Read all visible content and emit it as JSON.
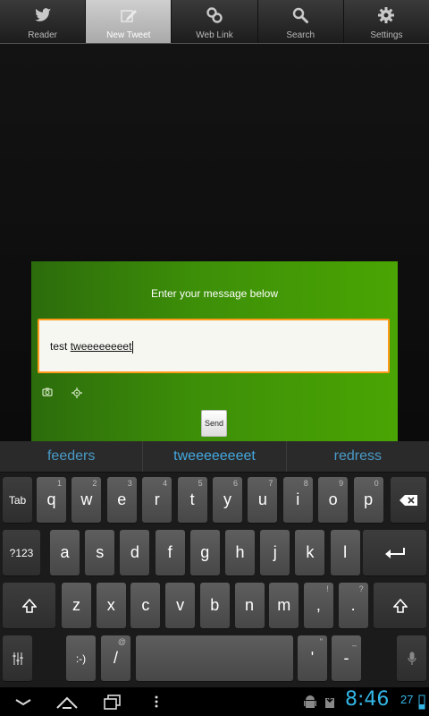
{
  "tabs": [
    {
      "label": "Reader",
      "icon": "bird-icon"
    },
    {
      "label": "New Tweet",
      "icon": "compose-icon"
    },
    {
      "label": "Web Link",
      "icon": "link-icon"
    },
    {
      "label": "Search",
      "icon": "search-icon"
    },
    {
      "label": "Settings",
      "icon": "gear-icon"
    }
  ],
  "active_tab": "New Tweet",
  "dialog": {
    "title": "Enter your message below",
    "message_value": "test tweeeeeeeet",
    "message_prefix": "test ",
    "message_underlined": "tweeeeeeeet",
    "send_label": "Send",
    "colors": {
      "border_focus": "#ff9a1a",
      "background": "#3d8f08"
    }
  },
  "suggestions": [
    "feeders",
    "tweeeeeeeet",
    "redress"
  ],
  "keyboard": {
    "row1_lead": "Tab",
    "row1": [
      {
        "k": "q",
        "h": "1"
      },
      {
        "k": "w",
        "h": "2"
      },
      {
        "k": "e",
        "h": "3"
      },
      {
        "k": "r",
        "h": "4"
      },
      {
        "k": "t",
        "h": "5"
      },
      {
        "k": "y",
        "h": "6"
      },
      {
        "k": "u",
        "h": "7"
      },
      {
        "k": "i",
        "h": "8"
      },
      {
        "k": "o",
        "h": "9"
      },
      {
        "k": "p",
        "h": "0"
      }
    ],
    "row2_lead": "?123",
    "row2": [
      {
        "k": "a"
      },
      {
        "k": "s"
      },
      {
        "k": "d"
      },
      {
        "k": "f"
      },
      {
        "k": "g"
      },
      {
        "k": "h"
      },
      {
        "k": "j"
      },
      {
        "k": "k"
      },
      {
        "k": "l"
      }
    ],
    "row3": [
      {
        "k": "z"
      },
      {
        "k": "x"
      },
      {
        "k": "c"
      },
      {
        "k": "v"
      },
      {
        "k": "b"
      },
      {
        "k": "n"
      },
      {
        "k": "m"
      },
      {
        "k": ",",
        "h": "!"
      },
      {
        "k": ".",
        "h": "?"
      }
    ],
    "row4": {
      "smiley": ":-)",
      "slash": "/",
      "slash_hint": "@",
      "apos": "'",
      "apos_hint": "\"",
      "dash": "-",
      "dash_hint": "_"
    }
  },
  "status": {
    "time": "8:46",
    "battery": "27"
  },
  "accent": "#33b5e5"
}
